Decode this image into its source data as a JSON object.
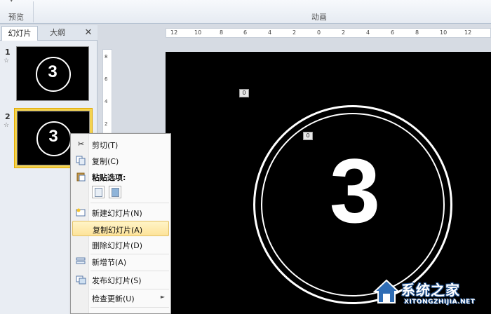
{
  "ribbon": {
    "preview_group_label": "预览",
    "animation_group_label": "动画"
  },
  "panel": {
    "tabs": [
      {
        "label": "幻灯片"
      },
      {
        "label": "大纲"
      }
    ],
    "close_glyph": "✕",
    "slides": [
      {
        "number": "1",
        "star": "☆",
        "digit": "3"
      },
      {
        "number": "2",
        "star": "☆",
        "digit": "3"
      }
    ]
  },
  "ruler": {
    "h_labels": [
      "12",
      "10",
      "8",
      "6",
      "4",
      "2",
      "0",
      "2",
      "4",
      "6",
      "8",
      "10",
      "12"
    ],
    "v_labels": [
      "8",
      "6",
      "4",
      "2"
    ]
  },
  "slide": {
    "digit": "3",
    "animation_tags": [
      "0",
      "0"
    ]
  },
  "context_menu": {
    "items": [
      {
        "label": "剪切(T)",
        "icon": "scissors-icon"
      },
      {
        "label": "复制(C)",
        "icon": "copy-icon"
      },
      {
        "label": "粘贴选项:",
        "icon": "paste-icon"
      },
      {
        "label": "新建幻灯片(N)",
        "icon": "new-slide-icon"
      },
      {
        "label": "复制幻灯片(A)",
        "icon": ""
      },
      {
        "label": "删除幻灯片(D)",
        "icon": ""
      },
      {
        "label": "新增节(A)",
        "icon": "new-section-icon"
      },
      {
        "label": "发布幻灯片(S)",
        "icon": "publish-slides-icon"
      },
      {
        "label": "检查更新(U)",
        "icon": ""
      }
    ],
    "submenu_arrow": "►",
    "highlight_color": "#fde399"
  },
  "watermark": {
    "text": "系统之家",
    "url": "XITONGZHIJIA.NET"
  }
}
